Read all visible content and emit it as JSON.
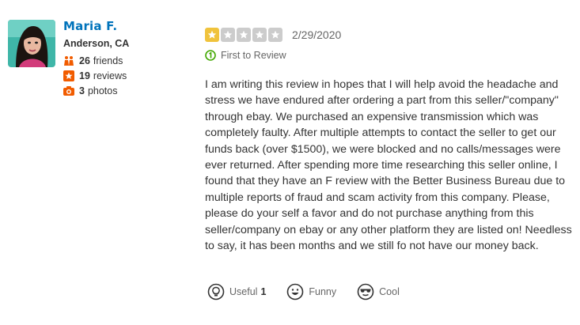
{
  "user": {
    "name": "Maria F.",
    "location": "Anderson, CA",
    "friends_count": "26",
    "friends_label": "friends",
    "reviews_count": "19",
    "reviews_label": "reviews",
    "photos_count": "3",
    "photos_label": "photos"
  },
  "review": {
    "rating": 1,
    "rating_max": 5,
    "date": "2/29/2020",
    "first_to_review": "First to Review",
    "text": "I am writing this review in hopes that I will help avoid the headache and stress we have endured after ordering a part from this seller/\"company\" through ebay. We purchased an expensive transmission which was completely faulty. After multiple attempts to contact the seller to get our funds back (over $1500), we were blocked and no calls/messages were ever returned. After spending more time researching this seller online, I found that they have an F review with the Better Business Bureau due to multiple reports of fraud and scam activity from this company. Please, please do your self a favor and do not purchase anything from this seller/company on ebay or any other platform they are listed on! Needless to say, it has been months and we still fo not have our money back."
  },
  "actions": {
    "useful_label": "Useful",
    "useful_count": "1",
    "funny_label": "Funny",
    "cool_label": "Cool"
  },
  "colors": {
    "name": "#0073bb",
    "star_on": "#f0c33c",
    "star_off": "#cccccc",
    "stat_icon": "#f15c00"
  },
  "icons": {
    "friends": "friends-icon",
    "reviews": "star-badge-icon",
    "photos": "camera-icon",
    "first_review": "first-to-review-icon",
    "useful": "lightbulb-icon",
    "funny": "smile-icon",
    "cool": "sunglasses-icon"
  }
}
